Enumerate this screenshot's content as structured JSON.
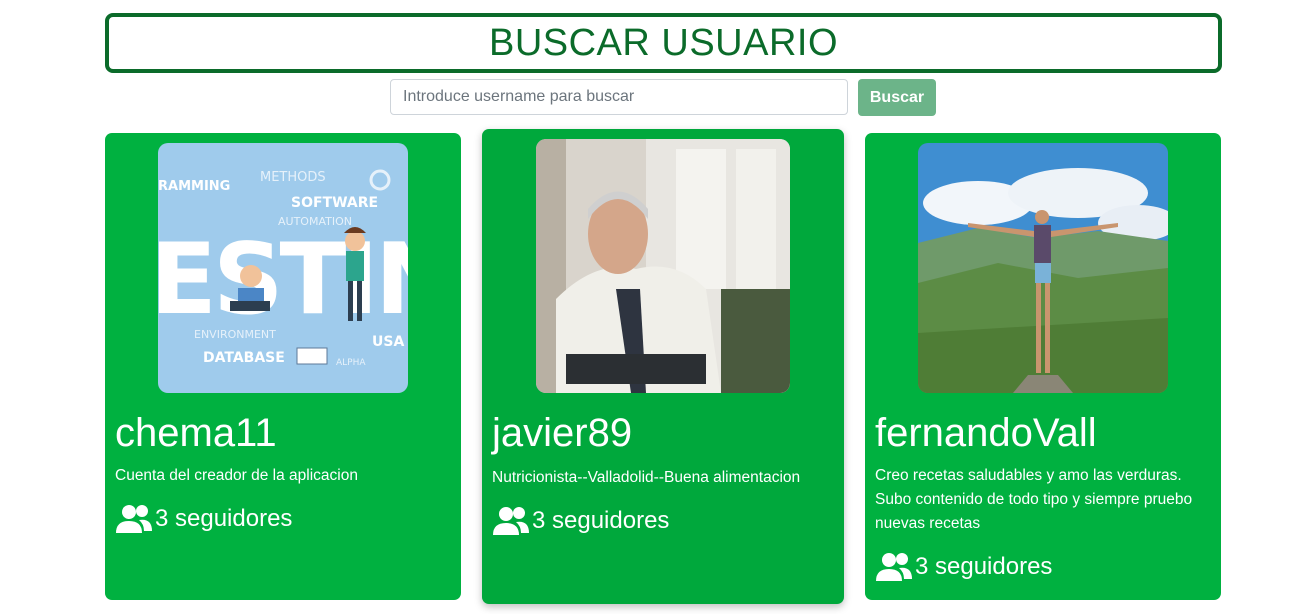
{
  "header": {
    "title": "BUSCAR USUARIO"
  },
  "search": {
    "placeholder": "Introduce username para buscar",
    "value": "",
    "button_label": "Buscar"
  },
  "users": [
    {
      "username": "chema11",
      "bio": "Cuenta del creador de la aplicacion",
      "followers_text": "3 seguidores",
      "image_words": [
        "RAMMING",
        "METHODS",
        "SOFTWARE",
        "AUTOMATION",
        "ESTIN",
        "ENVIRONMENT",
        "DATABASE",
        "USA",
        "ALPHA"
      ]
    },
    {
      "username": "javier89",
      "bio": "Nutricionista--Valladolid--Buena alimentacion",
      "followers_text": "3 seguidores"
    },
    {
      "username": "fernandoVall",
      "bio": "Creo recetas saludables y amo las verduras. Subo contenido de todo tipo y siempre pruebo nuevas recetas",
      "followers_text": "3 seguidores"
    }
  ],
  "colors": {
    "primary_green": "#00b140",
    "dark_green": "#0b6b2a",
    "button_green": "#6cb489"
  },
  "icons": {
    "followers": "users-icon"
  }
}
